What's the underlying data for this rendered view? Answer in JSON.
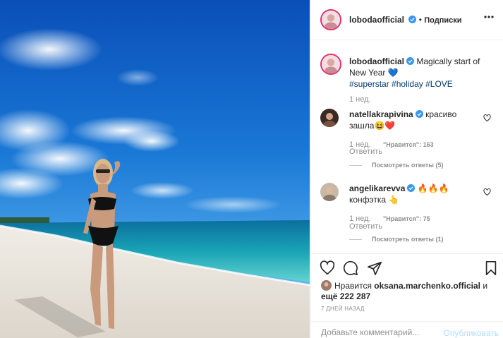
{
  "post": {
    "author": "lobodaofficial",
    "follow_label": "Подписки",
    "separator": "•",
    "caption_text": "Magically start of New Year",
    "caption_emoji": "💙",
    "hashtags": [
      "#superstar",
      "#holiday",
      "#LOVE"
    ],
    "caption_age": "1 нед."
  },
  "comments": [
    {
      "author": "natellakrapivina",
      "text": "красиво зашла",
      "emoji": "😆❤️",
      "age": "1 нед.",
      "likes": "\"Нравится\": 163",
      "reply_label": "Ответить",
      "view_replies": "Посмотреть ответы (5)"
    },
    {
      "author": "angelikarevva",
      "text": "🔥🔥🔥",
      "text2": "конфэтка",
      "emoji": "👆",
      "age": "1 нед.",
      "likes": "\"Нравится\": 75",
      "reply_label": "Ответить",
      "view_replies": "Посмотреть ответы (1)"
    }
  ],
  "likes_line": {
    "prefix": "Нравится",
    "user": "oksana.marchenko.official",
    "joiner": "и",
    "rest": "ещё 222 287"
  },
  "date": "7 ДНЕЙ НАЗАД",
  "comment_input": {
    "placeholder": "Добавьте комментарий..."
  },
  "post_button": "Опубликовать",
  "icons": [
    "more-icon",
    "heart-icon",
    "comment-icon",
    "share-icon",
    "bookmark-icon",
    "verified-icon"
  ],
  "colors": {
    "link": "#00376b",
    "muted": "#8e8e8e",
    "verified": "#3897f0",
    "post_disabled": "#b2dffc"
  }
}
